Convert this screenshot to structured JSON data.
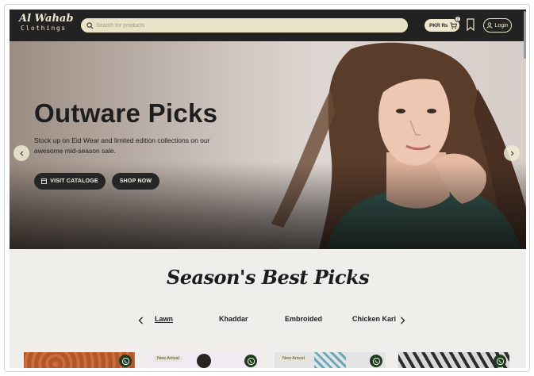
{
  "header": {
    "logo_main": "Al Wahab",
    "logo_sub": "Clothings",
    "search_placeholder": "Search for products",
    "currency": "PKR ₨",
    "cart_count": "0",
    "login_label": "Login"
  },
  "hero": {
    "title": "Outware Picks",
    "description": "Stock up on Eid Wear and limited edition collections on our awesome mid-season sale.",
    "catalog_button": "VISIT CATALOGE",
    "shop_button": "SHOP NOW"
  },
  "section": {
    "title": "Season's Best Picks",
    "tabs": [
      {
        "label": "Lawn",
        "active": true
      },
      {
        "label": "Khaddar",
        "active": false
      },
      {
        "label": "Embroided",
        "active": false
      },
      {
        "label": "Chicken Kari",
        "active": false
      }
    ]
  },
  "products": [
    {
      "badge": ""
    },
    {
      "badge": "New Arrival"
    },
    {
      "badge": "New Arrival"
    },
    {
      "badge": ""
    }
  ],
  "colors": {
    "header_bg": "#222222",
    "search_bg": "#e8e3c7",
    "page_bg": "#efeeea",
    "button_dark": "#262626",
    "whatsapp_bg": "#1f3b1d"
  }
}
